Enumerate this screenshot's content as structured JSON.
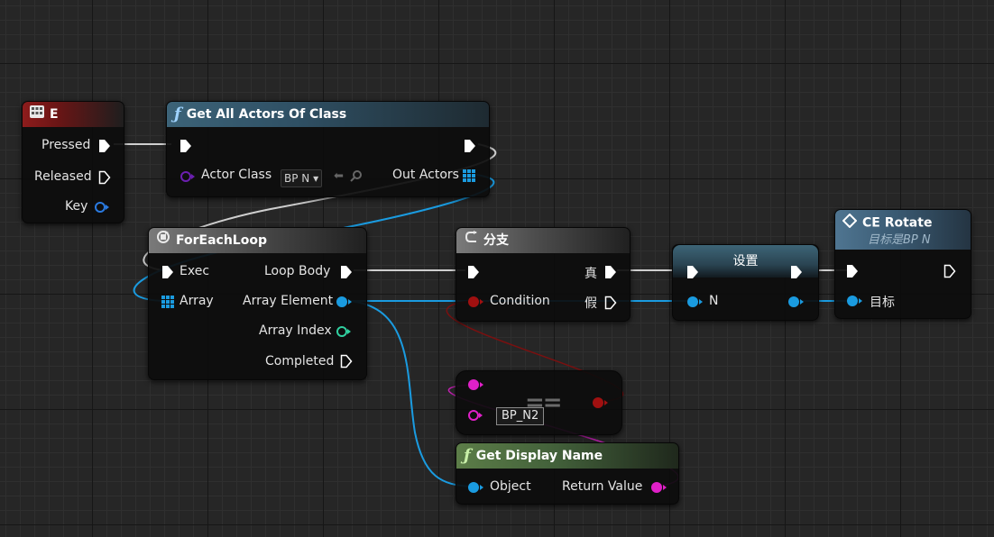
{
  "nodes": {
    "e_key": {
      "title": "E",
      "pins": {
        "pressed": "Pressed",
        "released": "Released",
        "key": "Key"
      }
    },
    "get_all_actors": {
      "title": "Get All Actors Of Class",
      "pins": {
        "actor_class": "Actor Class",
        "out_actors": "Out Actors"
      },
      "actor_class_value": "BP N",
      "actor_class_arrow": "▾"
    },
    "foreach": {
      "title": "ForEachLoop",
      "pins": {
        "exec": "Exec",
        "array": "Array",
        "loop_body": "Loop Body",
        "array_element": "Array Element",
        "array_index": "Array Index",
        "completed": "Completed"
      }
    },
    "branch": {
      "title": "分支",
      "pins": {
        "condition": "Condition",
        "true": "真",
        "false": "假"
      }
    },
    "set": {
      "title": "设置",
      "pins": {
        "n": "N"
      }
    },
    "equal": {
      "symbol": "==",
      "object_value": "BP_N2"
    },
    "get_display_name": {
      "title": "Get Display Name",
      "pins": {
        "object": "Object",
        "return_value": "Return Value"
      }
    },
    "ce_rotate": {
      "title": "CE Rotate",
      "subtitle": "目标是BP N",
      "pins": {
        "target": "目标"
      }
    }
  },
  "colors": {
    "exec": "#ffffff",
    "object": "#1a9be0",
    "class": "#6b1fb0",
    "bool": "#a01010",
    "string": "#e020c8",
    "integer": "#30d0a0",
    "key_struct": "#2a7ae0",
    "wire_bool": "#7a1010",
    "wire_string": "#c020b0"
  },
  "icons": {
    "event": "keyboard-icon",
    "function": "function-icon",
    "loop": "loop-icon",
    "branch": "branch-icon",
    "event_call": "diamond-icon"
  }
}
